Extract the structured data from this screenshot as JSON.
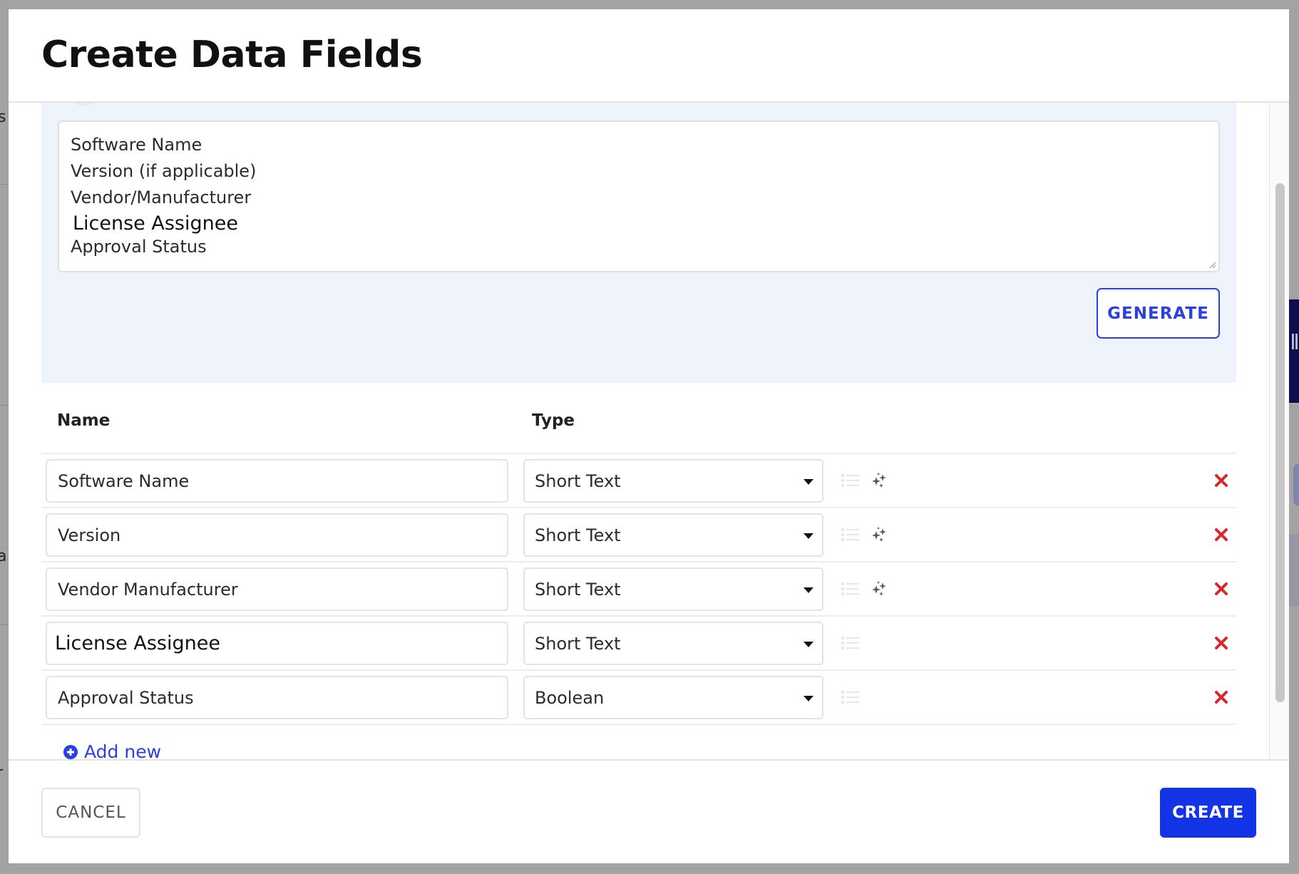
{
  "dialog": {
    "title": "Create Data Fields"
  },
  "generator": {
    "prompt_lines": [
      "Software Name",
      "Version (if applicable)",
      "Vendor/Manufacturer",
      "License Assignee",
      "Approval Status"
    ],
    "generate_label": "GENERATE"
  },
  "table": {
    "headers": {
      "name": "Name",
      "type": "Type"
    },
    "rows": [
      {
        "name": "Software Name",
        "type": "Short Text",
        "has_ai": true
      },
      {
        "name": "Version",
        "type": "Short Text",
        "has_ai": true
      },
      {
        "name": "Vendor Manufacturer",
        "type": "Short Text",
        "has_ai": true
      },
      {
        "name": "License Assignee",
        "type": "Short Text",
        "has_ai": false
      },
      {
        "name": "Approval Status",
        "type": "Boolean",
        "has_ai": false
      }
    ],
    "add_new_label": "Add new"
  },
  "footer": {
    "cancel_label": "CANCEL",
    "create_label": "CREATE"
  },
  "icons": {
    "row_options": "list-icon",
    "ai_fill": "sparkle-icon",
    "remove": "close-icon",
    "add": "plus-circle-icon",
    "type_dropdown": "caret-down-icon"
  },
  "colors": {
    "accent": "#1233e6",
    "danger": "#d9262e",
    "panel_bg": "#eff3fb",
    "overlay": "#a3a3a3"
  },
  "background_fragments": [
    "s",
    "a",
    "r"
  ]
}
